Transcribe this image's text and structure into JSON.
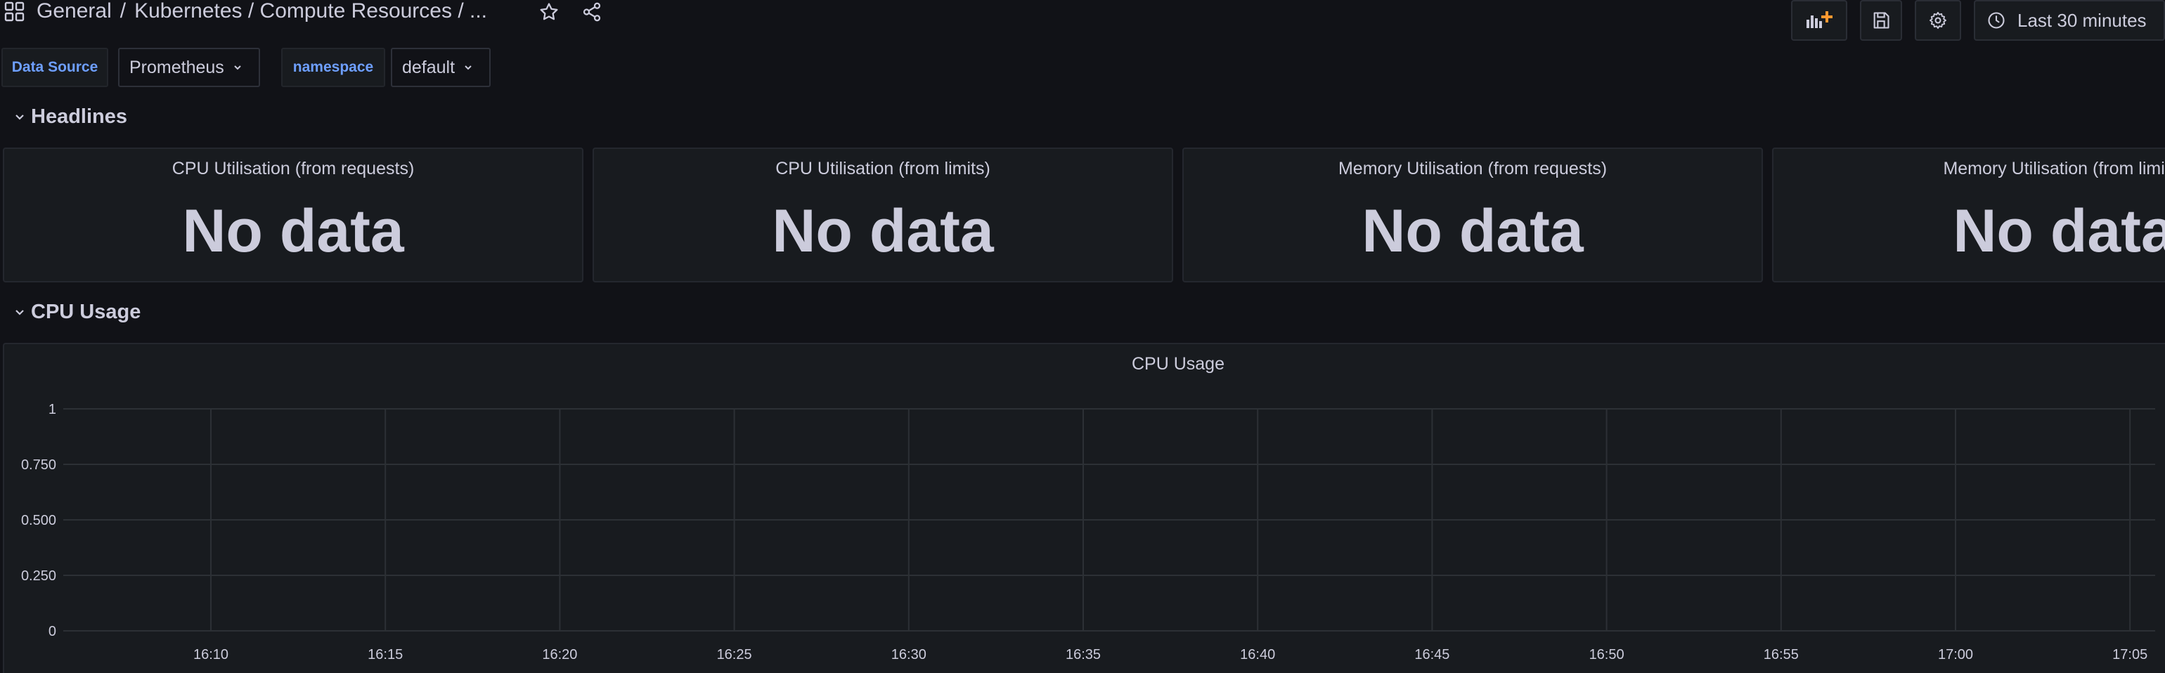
{
  "navbar": {
    "breadcrumb_folder": "General",
    "breadcrumb_sep": "/",
    "breadcrumb_title": "Kubernetes / Compute Resources / ...",
    "time_range": "Last 30 minutes"
  },
  "variables": [
    {
      "label": "Data Source",
      "value": "Prometheus"
    },
    {
      "label": "namespace",
      "value": "default"
    }
  ],
  "rows": {
    "headlines": "Headlines",
    "cpu_usage": "CPU Usage"
  },
  "stat_panels": [
    {
      "title": "CPU Utilisation (from requests)",
      "value": "No data"
    },
    {
      "title": "CPU Utilisation (from limits)",
      "value": "No data"
    },
    {
      "title": "Memory Utilisation (from requests)",
      "value": "No data"
    },
    {
      "title": "Memory Utilisation (from limits)",
      "value": "No data"
    }
  ],
  "graph_panel": {
    "title": "CPU Usage"
  },
  "colors": {
    "background": "#111217",
    "panel": "#181b1f",
    "text": "#ccccdc",
    "variable_label": "#6e9fff",
    "add_panel_accent": "#ff9830",
    "grid": "#2c3035"
  },
  "chart_data": {
    "type": "line",
    "title": "CPU Usage",
    "xlabel": "",
    "ylabel": "",
    "series": [],
    "x_tick_labels": [
      "16:10",
      "16:15",
      "16:20",
      "16:25",
      "16:30",
      "16:35",
      "16:40",
      "16:45",
      "16:50",
      "16:55",
      "17:00",
      "17:05"
    ],
    "y_tick_labels": [
      "1",
      "0.750",
      "0.500",
      "0.250",
      "0"
    ],
    "ylim": [
      0,
      1
    ],
    "grid": true
  }
}
